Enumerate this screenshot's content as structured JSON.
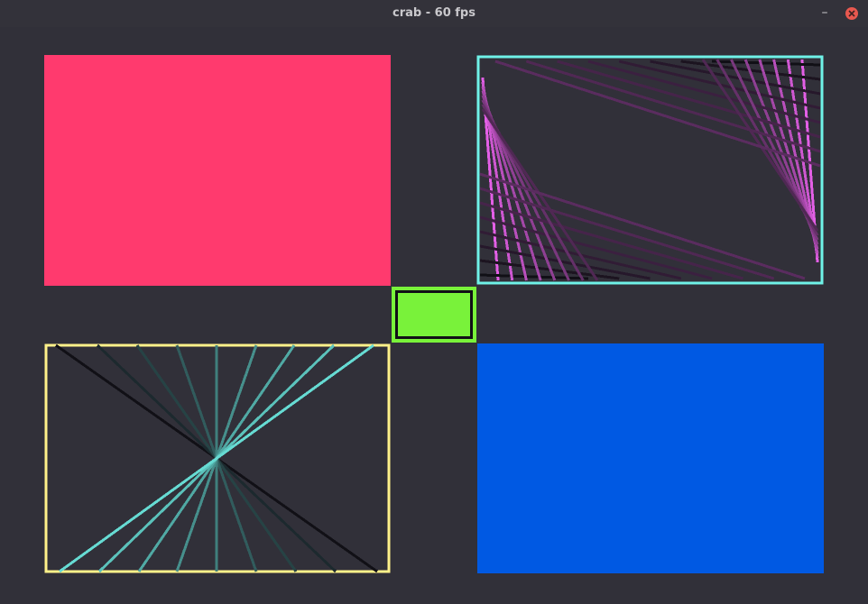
{
  "window": {
    "title": "crab - 60 fps",
    "minimize_glyph": "–",
    "close_icon": "close-icon"
  },
  "colors": {
    "background": "#313039",
    "pink": "#ff3a6e",
    "cyan": "#6ff2e8",
    "magenta": "#e35fe6",
    "yellow": "#fff18a",
    "teal": "#6ff2e8",
    "green": "#79f23a",
    "blue": "#0059e3",
    "dark": "#111016"
  }
}
